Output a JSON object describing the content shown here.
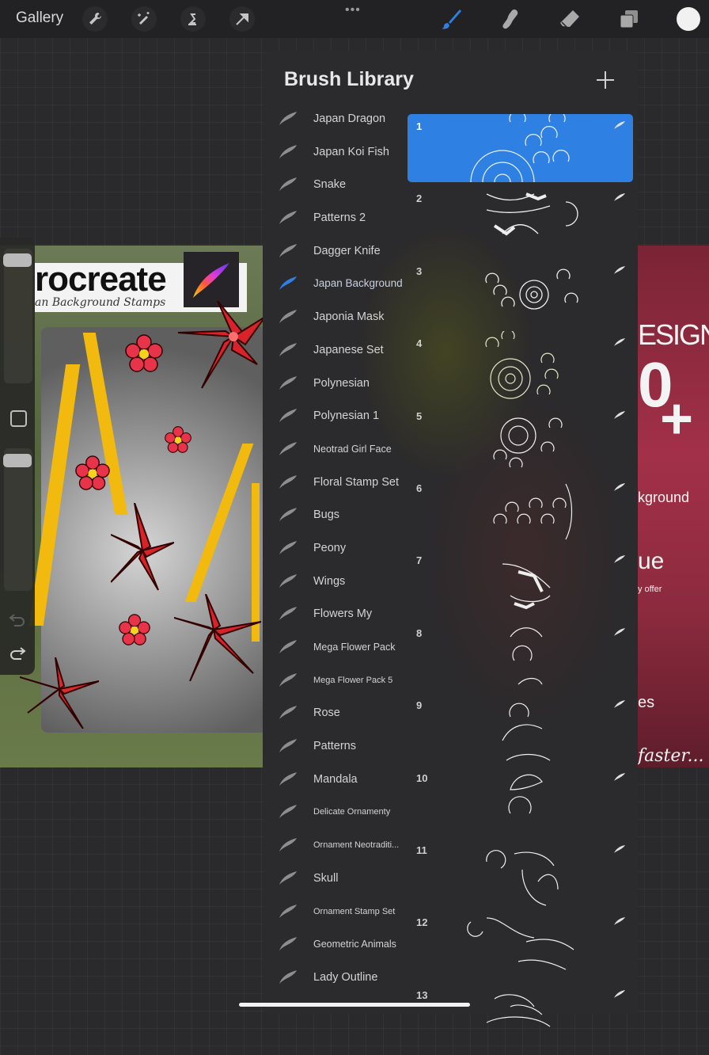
{
  "toolbar": {
    "gallery_label": "Gallery",
    "left_icons": [
      "wrench-icon",
      "magic-wand-icon",
      "selection-s-icon",
      "arrow-transform-icon"
    ],
    "more_label": "•••",
    "right_tools": [
      "brush-icon",
      "smudge-icon",
      "eraser-icon",
      "layers-icon"
    ],
    "active_tool": "brush",
    "accent_color": "#2f80e3",
    "current_color": "#f1f1f1"
  },
  "sidebar": {
    "brush_size_level": 0.05,
    "opacity_level": 0.05,
    "undo_label": "undo",
    "redo_label": "redo"
  },
  "canvas_left": {
    "title": "rocreate",
    "subtitle": "an Background Stamps"
  },
  "canvas_right": {
    "word1": "ESIGN",
    "big": "0",
    "plus": "+",
    "word2": "kground",
    "word3": "ue",
    "word4": "y offer",
    "word5": "es",
    "word6": "faster..."
  },
  "brush_library": {
    "title": "Brush Library",
    "add_label": "+",
    "active_set": "Japan Background",
    "sets": [
      {
        "label": "Japan Dragon",
        "size": "normal"
      },
      {
        "label": "Japan Koi Fish",
        "size": "normal"
      },
      {
        "label": "Snake",
        "size": "normal"
      },
      {
        "label": "Patterns 2",
        "size": "normal"
      },
      {
        "label": "Dagger Knife",
        "size": "normal"
      },
      {
        "label": "Japan Background",
        "size": "normal",
        "active": true
      },
      {
        "label": "Japonia Mask",
        "size": "normal"
      },
      {
        "label": "Japanese Set",
        "size": "normal"
      },
      {
        "label": "Polynesian",
        "size": "normal"
      },
      {
        "label": "Polynesian 1",
        "size": "normal"
      },
      {
        "label": "Neotrad Girl Face",
        "size": "small"
      },
      {
        "label": "Floral Stamp Set",
        "size": "normal"
      },
      {
        "label": "Bugs",
        "size": "normal"
      },
      {
        "label": "Peony",
        "size": "normal"
      },
      {
        "label": "Wings",
        "size": "normal"
      },
      {
        "label": "Flowers My",
        "size": "normal"
      },
      {
        "label": "Mega Flower Pack",
        "size": "small"
      },
      {
        "label": "Mega Flower Pack 5",
        "size": "tiny"
      },
      {
        "label": "Rose",
        "size": "normal"
      },
      {
        "label": "Patterns",
        "size": "normal"
      },
      {
        "label": "Mandala",
        "size": "normal"
      },
      {
        "label": "Delicate Ornamenty",
        "size": "tiny"
      },
      {
        "label": "Ornament Neotraditi...",
        "size": "tiny"
      },
      {
        "label": "Skull",
        "size": "normal"
      },
      {
        "label": "Ornament Stamp Set",
        "size": "tiny"
      },
      {
        "label": "Geometric Animals",
        "size": "small"
      },
      {
        "label": "Lady Outline",
        "size": "normal"
      }
    ],
    "brushes": [
      {
        "number": "1",
        "selected": true
      },
      {
        "number": "2"
      },
      {
        "number": "3"
      },
      {
        "number": "4"
      },
      {
        "number": "5"
      },
      {
        "number": "6"
      },
      {
        "number": "7"
      },
      {
        "number": "8"
      },
      {
        "number": "9"
      },
      {
        "number": "10"
      },
      {
        "number": "11"
      },
      {
        "number": "12"
      },
      {
        "number": "13"
      }
    ]
  }
}
